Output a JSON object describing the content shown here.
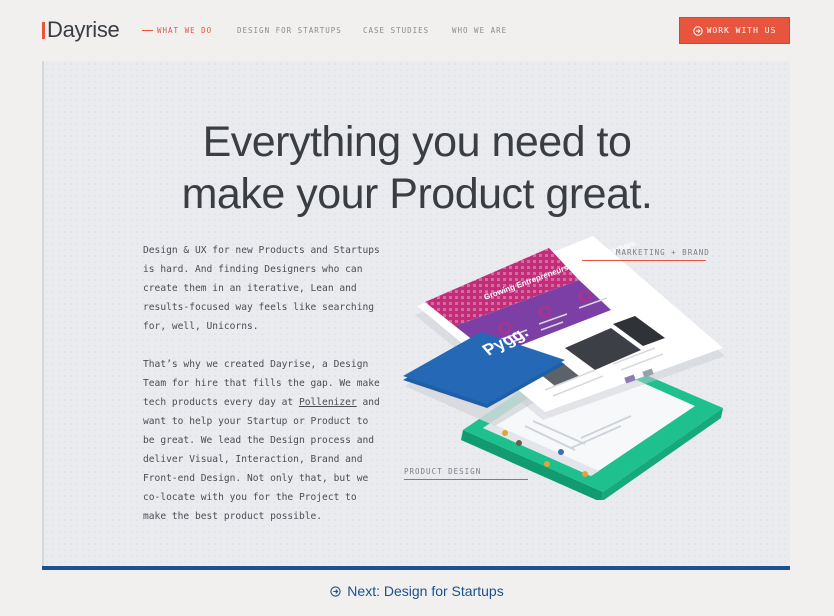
{
  "brand": {
    "name": "Dayrise"
  },
  "nav": {
    "items": [
      {
        "label": "WHAT WE DO",
        "active": true
      },
      {
        "label": "DESIGN FOR STARTUPS",
        "active": false
      },
      {
        "label": "CASE STUDIES",
        "active": false
      },
      {
        "label": "WHO WE ARE",
        "active": false
      }
    ],
    "cta_label": "WORK WITH US"
  },
  "hero": {
    "headline_line1": "Everything you need to",
    "headline_line2": "make your Product great.",
    "paragraph1": [
      "Design & UX for new Products and Startups",
      "is hard. And finding Designers who can",
      "create them in an iterative, Lean and",
      "results-focused way feels like searching",
      "for, well, Unicorns."
    ],
    "paragraph2": [
      "That’s why we created Dayrise, a Design",
      "Team for hire that fills the gap. We make",
      "tech products every day at ",
      "Pollenizer",
      " and",
      "want to help your Startup or Product to",
      "be great. We lead the Design process and",
      "deliver Visual, Interaction, Brand and",
      "Front-end Design. Not only that, but we",
      "co-locate with you for the Project to",
      "make the best product possible."
    ]
  },
  "illustration": {
    "label_marketing": "MARKETING + BRAND",
    "label_product": "PRODUCT DESIGN",
    "brand_card_text": "Pygg.",
    "banner_text": "Growing Entrepreneurs. Building Startups."
  },
  "footer": {
    "next_label": "Next: Design for Startups"
  },
  "colors": {
    "accent": "#e8553e",
    "blue": "#1c4f93",
    "green": "#1ec08d",
    "purple": "#7b3fa6",
    "magenta": "#c12d78"
  }
}
